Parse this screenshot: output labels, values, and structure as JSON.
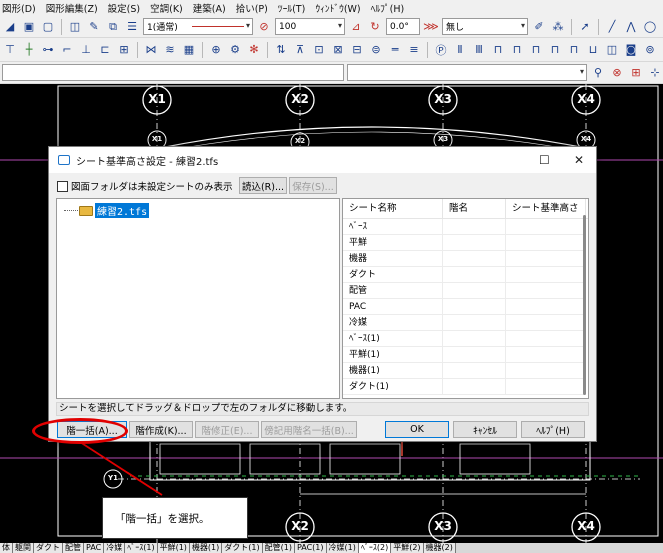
{
  "menubar": {
    "items": [
      "図形(D)",
      "図形編集(Z)",
      "設定(S)",
      "空調(K)",
      "建築(A)",
      "拾い(P)",
      "ﾂｰﾙ(T)",
      "ｳｨﾝﾄﾞｳ(W)",
      "ﾍﾙﾌﾟ(H)"
    ]
  },
  "toolbar": {
    "layer_combo": "1(通常)",
    "zoom_combo": "100",
    "angle_combo": "0.0°",
    "fill_combo": "無し"
  },
  "drawing": {
    "grid_top": [
      "X1",
      "X2",
      "X3",
      "X4"
    ],
    "grid_second": [
      "X1",
      "X2",
      "X3",
      "X4"
    ],
    "grid_bottom": [
      "X2",
      "X3",
      "X4"
    ],
    "grid_left": "Y1"
  },
  "sheet_tabs": [
    "体",
    "躯関",
    "ダクト",
    "配管",
    "PAC",
    "冷媒",
    "ﾍﾞｰｽ(1)",
    "平鮮(1)",
    "機器(1)",
    "ダクト(1)",
    "配管(1)",
    "PAC(1)",
    "冷媒(1)",
    "ﾍﾞｰｽ(2)",
    "平鮮(2)",
    "機器(2)"
  ],
  "dialog": {
    "title": "シート基準高さ設定 - 練習2.tfs",
    "checkbox_label": "図面フォルダは未設定シートのみ表示",
    "read_button": "読込(R)...",
    "save_button": "保存(S)...",
    "tree_root": "練習2.tfs",
    "columns": [
      "シート名称",
      "階名",
      "シート基準高さ"
    ],
    "rows": [
      "ﾍﾞｰｽ",
      "平鮮",
      "機器",
      "ダクト",
      "配管",
      "PAC",
      "冷媒",
      "ﾍﾞｰｽ(1)",
      "平鮮(1)",
      "機器(1)",
      "ダクト(1)"
    ],
    "status": "シートを選択してドラッグ＆ドロップで左のフォルダに移動します。",
    "buttons": {
      "bulk_floor": "階一括(A)...",
      "create_floor": "階作成(K)...",
      "edit_floor": "階修正(E)...",
      "note_floor": "傍記用階名一括(B)...",
      "ok": "OK",
      "cancel": "ｷｬﾝｾﾙ",
      "help": "ﾍﾙﾌﾟ(H)"
    }
  },
  "annotation": {
    "callout": "「階一括」を選択。",
    "color": "#e00000"
  }
}
